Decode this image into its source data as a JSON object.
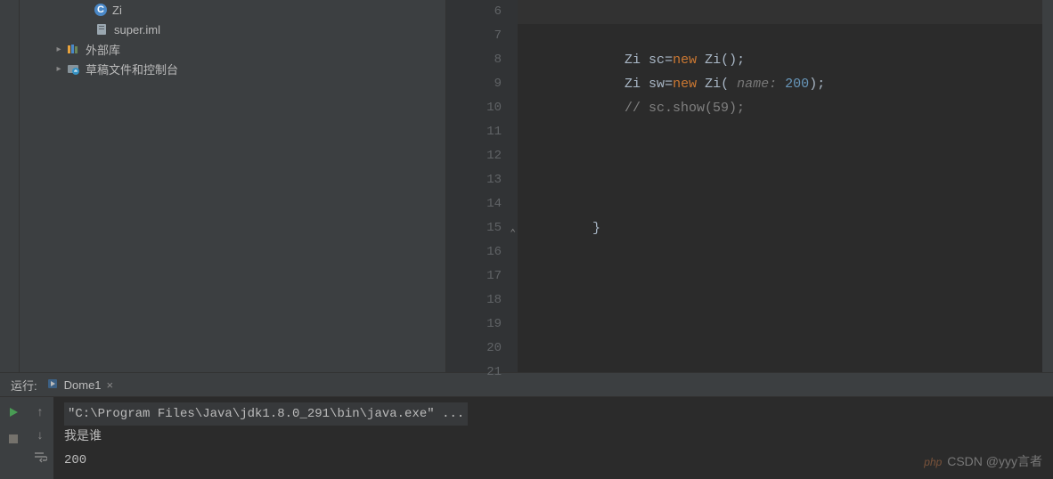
{
  "project": {
    "items": [
      {
        "label": "Zi",
        "icon": "class",
        "level": 1,
        "expandable": false
      },
      {
        "label": "super.iml",
        "icon": "iml",
        "level": 1,
        "expandable": false
      },
      {
        "label": "外部库",
        "icon": "lib",
        "level": 0,
        "expandable": true
      },
      {
        "label": "草稿文件和控制台",
        "icon": "scratch",
        "level": 0,
        "expandable": true
      }
    ]
  },
  "editor": {
    "first_line": 6,
    "last_line": 21,
    "lines": [
      {
        "n": 6,
        "html": "<span class='caret'></span>",
        "hl": true
      },
      {
        "n": 7,
        "html": ""
      },
      {
        "n": 8,
        "html": "        <span class='type'>Zi</span> <span class='var'>sc</span>=<span class='kw'>new</span> <span class='type'>Zi</span>();"
      },
      {
        "n": 9,
        "html": "        <span class='type'>Zi</span> <span class='var'>sw</span>=<span class='kw'>new</span> <span class='type'>Zi</span>( <span class='param-hint'>name:</span> <span class='num'>200</span>);"
      },
      {
        "n": 10,
        "html": "        <span class='cmt'>// sc.show(59);</span>"
      },
      {
        "n": 11,
        "html": ""
      },
      {
        "n": 12,
        "html": ""
      },
      {
        "n": 13,
        "html": ""
      },
      {
        "n": 14,
        "html": ""
      },
      {
        "n": 15,
        "html": "    }",
        "fold": "end"
      },
      {
        "n": 16,
        "html": ""
      },
      {
        "n": 17,
        "html": ""
      },
      {
        "n": 18,
        "html": ""
      },
      {
        "n": 19,
        "html": ""
      },
      {
        "n": 20,
        "html": ""
      },
      {
        "n": 21,
        "html": ""
      }
    ]
  },
  "run": {
    "header_label": "运行:",
    "tab_label": "Dome1",
    "console_lines": [
      {
        "text": "\"C:\\Program Files\\Java\\jdk1.8.0_291\\bin\\java.exe\" ...",
        "cmd": true
      },
      {
        "text": "我是谁",
        "cmd": false
      },
      {
        "text": "200",
        "cmd": false
      }
    ]
  },
  "watermark": {
    "badge": "php",
    "text": "CSDN @yyy言者"
  }
}
